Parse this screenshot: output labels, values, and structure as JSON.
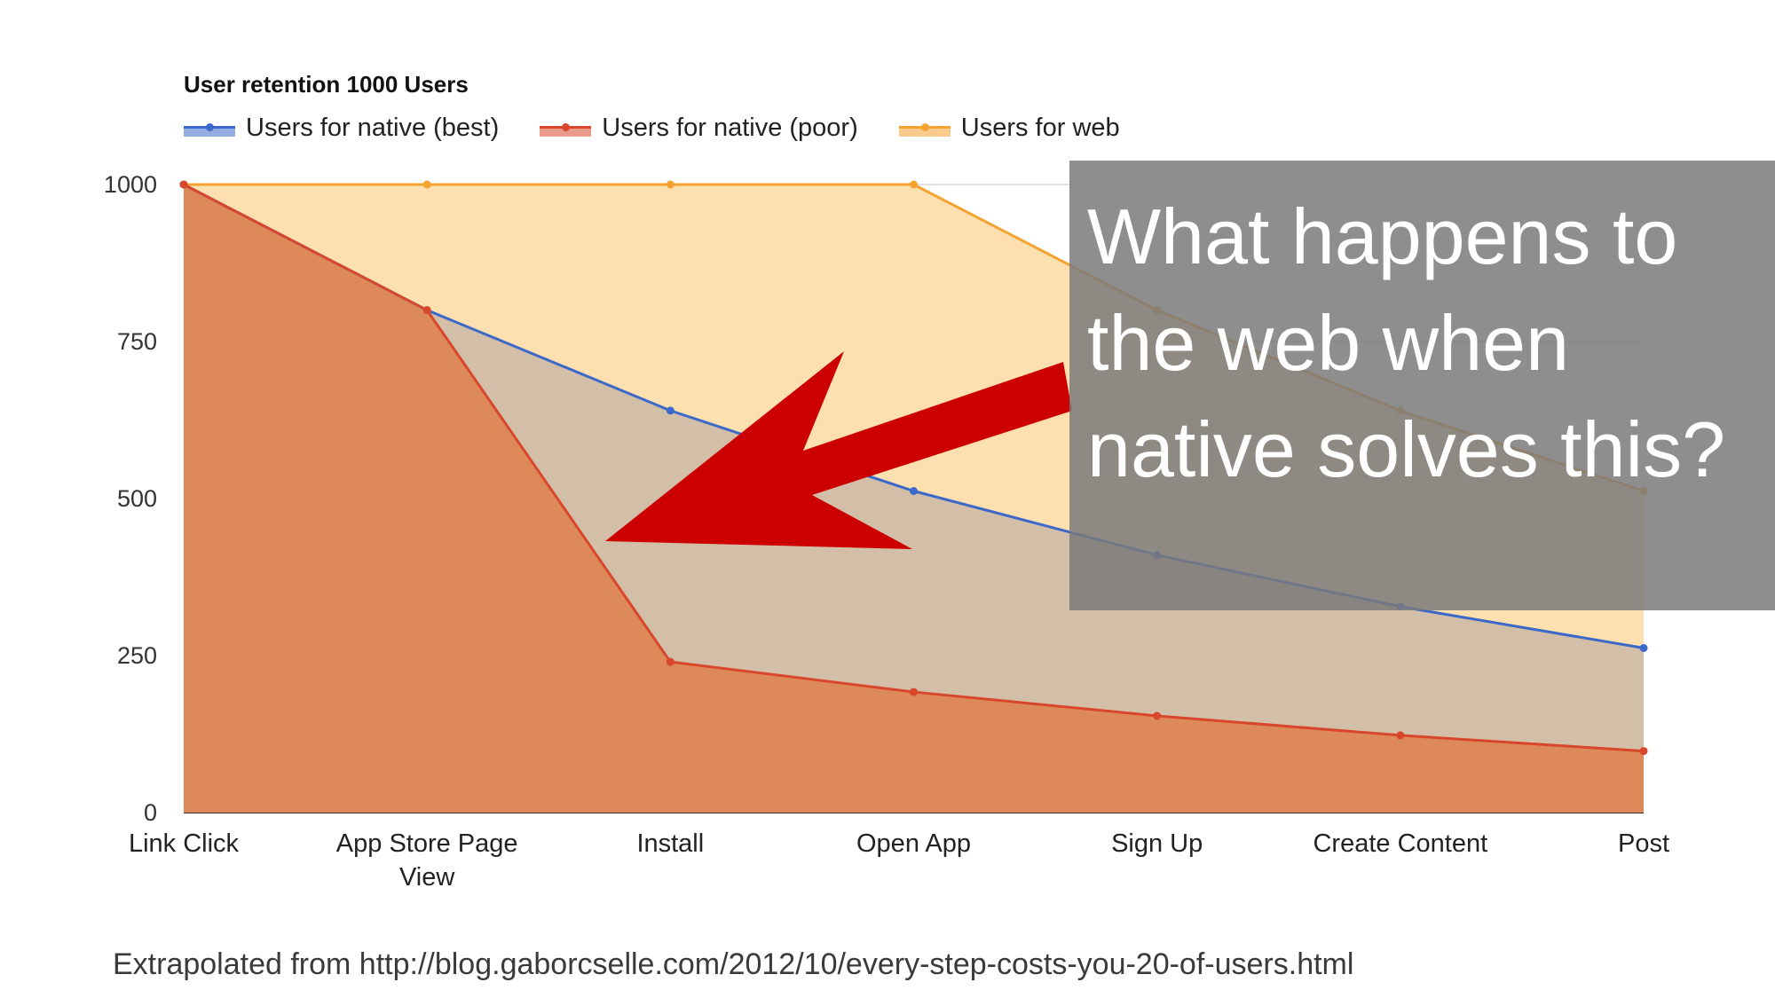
{
  "chart_data": {
    "type": "area",
    "title": "User retention 1000 Users",
    "categories": [
      "Link Click",
      "App Store Page View",
      "Install",
      "Open App",
      "Sign Up",
      "Create Content",
      "Post"
    ],
    "ylim": [
      0,
      1000
    ],
    "yticks": [
      0,
      250,
      500,
      750,
      1000
    ],
    "grid": true,
    "legend_position": "top-left",
    "series": [
      {
        "name": "Users for web",
        "color": "#f4a330",
        "fill": "#fddfb0",
        "values": [
          1000,
          1000,
          1000,
          1000,
          800,
          640,
          512
        ]
      },
      {
        "name": "Users for native (best)",
        "color": "#3c69c9",
        "fill": "#d3bfa7",
        "values": [
          1000,
          800,
          640,
          512,
          410,
          328,
          262
        ]
      },
      {
        "name": "Users for native (poor)",
        "color": "#d8472c",
        "fill": "#dd8959",
        "values": [
          1000,
          800,
          240,
          192,
          154,
          123,
          98
        ]
      }
    ],
    "legend_order": [
      1,
      2,
      0
    ]
  },
  "callout": {
    "text": "What happens to the web when native solves this?"
  },
  "annotation": {
    "arrow_color": "#cc0000"
  },
  "source": "Extrapolated from http://blog.gaborcselle.com/2012/10/every-step-costs-you-20-of-users.html"
}
